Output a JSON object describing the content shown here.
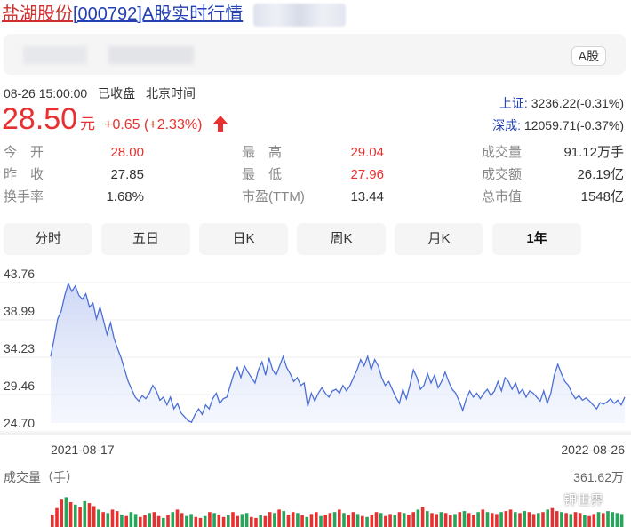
{
  "header": {
    "stock_name": "盐湖股份",
    "rest": "[000792]A股实时行情"
  },
  "info_bar": {
    "badge": "A股"
  },
  "status": {
    "datetime": "08-26 15:00:00",
    "state": "已收盘",
    "timezone": "北京时间"
  },
  "quote": {
    "price": "28.50",
    "unit": "元",
    "change": "+0.65 (+2.33%)"
  },
  "indices": [
    {
      "label": "上证:",
      "value": "3236.22(-0.31%)"
    },
    {
      "label": "深成:",
      "value": "12059.71(-0.37%)"
    }
  ],
  "stats": [
    [
      {
        "label": "今　开",
        "value": "28.00",
        "color": "red"
      },
      {
        "label": "最　高",
        "value": "29.04",
        "color": "red"
      },
      {
        "label": "成交量",
        "value": "91.12万手",
        "color": "black"
      }
    ],
    [
      {
        "label": "昨　收",
        "value": "27.85",
        "color": "black"
      },
      {
        "label": "最　低",
        "value": "27.96",
        "color": "red"
      },
      {
        "label": "成交额",
        "value": "26.19亿",
        "color": "black"
      }
    ],
    [
      {
        "label": "换手率",
        "value": "1.68%",
        "color": "black"
      },
      {
        "label": "市盈(TTM)",
        "value": "13.44",
        "color": "black"
      },
      {
        "label": "总市值",
        "value": "1548亿",
        "color": "black"
      }
    ]
  ],
  "tabs": [
    {
      "label": "分时",
      "active": false
    },
    {
      "label": "五日",
      "active": false
    },
    {
      "label": "日K",
      "active": false
    },
    {
      "label": "周K",
      "active": false
    },
    {
      "label": "月K",
      "active": false
    },
    {
      "label": "1年",
      "active": true
    }
  ],
  "colors": {
    "up": "#e93030",
    "down": "#26a65b",
    "line": "#4b6fd6",
    "link": "#2440b3"
  },
  "chart_data": {
    "type": "area",
    "y_ticks": [
      "43.76",
      "38.99",
      "34.23",
      "29.46",
      "24.70"
    ],
    "ylim": [
      24.7,
      43.76
    ],
    "x_start_label": "2021-08-17",
    "x_end_label": "2022-08-26",
    "series": [
      {
        "values": [
          33.2,
          35.5,
          38.0,
          39.0,
          41.0,
          42.5,
          41.5,
          42.2,
          41.0,
          40.5,
          41.2,
          39.5,
          40.0,
          38.0,
          39.5,
          37.8,
          36.0,
          37.5,
          35.5,
          34.2,
          33.0,
          31.5,
          30.0,
          29.0,
          28.0,
          27.5,
          28.2,
          27.8,
          28.5,
          29.5,
          28.8,
          27.6,
          28.0,
          27.0,
          28.0,
          26.5,
          27.2,
          26.0,
          25.5,
          25.0,
          24.8,
          25.8,
          26.5,
          25.8,
          27.0,
          26.5,
          27.8,
          28.5,
          27.2,
          27.8,
          28.0,
          29.5,
          31.0,
          31.8,
          30.5,
          32.0,
          31.2,
          30.5,
          29.8,
          31.5,
          32.5,
          30.8,
          33.0,
          31.5,
          30.8,
          32.0,
          33.2,
          31.8,
          31.0,
          30.0,
          30.5,
          29.5,
          29.8,
          26.8,
          28.5,
          27.5,
          28.5,
          29.2,
          28.5,
          28.0,
          28.8,
          29.0,
          28.5,
          29.5,
          28.8,
          29.5,
          30.5,
          31.5,
          32.8,
          32.0,
          33.2,
          31.5,
          32.8,
          32.0,
          30.5,
          29.5,
          30.0,
          29.0,
          28.0,
          27.2,
          29.0,
          27.8,
          29.5,
          31.5,
          30.5,
          29.0,
          29.5,
          31.0,
          29.8,
          30.8,
          29.2,
          30.0,
          31.2,
          30.0,
          29.0,
          28.5,
          27.5,
          26.3,
          27.8,
          28.8,
          28.0,
          28.5,
          27.8,
          28.5,
          29.0,
          28.2,
          28.8,
          30.0,
          28.8,
          30.5,
          30.0,
          29.0,
          29.8,
          28.5,
          29.0,
          28.0,
          28.8,
          28.5,
          28.0,
          27.5,
          28.8,
          27.2,
          28.5,
          30.8,
          32.2,
          31.0,
          30.0,
          29.5,
          28.5,
          27.8,
          28.2,
          27.6,
          27.9,
          27.5,
          27.0,
          26.5,
          27.3,
          27.1,
          27.4,
          27.8,
          27.2,
          27.6,
          27.0,
          28.0
        ]
      }
    ]
  },
  "volume": {
    "label": "成交量（手）",
    "max_label": "361.62万",
    "bars": [
      0.25,
      0.38,
      0.55,
      0.6,
      0.5,
      0.45,
      0.4,
      0.52,
      0.48,
      0.42,
      0.35,
      0.3,
      0.28,
      0.35,
      0.32,
      0.25,
      0.22,
      0.3,
      0.26,
      0.2,
      0.24,
      0.28,
      0.3,
      0.22,
      0.18,
      0.25,
      0.3,
      0.35,
      0.28,
      0.22,
      0.26,
      0.2,
      0.18,
      0.22,
      0.3,
      0.28,
      0.25,
      0.2,
      0.24,
      0.3,
      0.22,
      0.26,
      0.28,
      0.2,
      0.18,
      0.24,
      0.22,
      0.3,
      0.28,
      0.35,
      0.32,
      0.25,
      0.3,
      0.28,
      0.24,
      0.2,
      0.26,
      0.3,
      0.22,
      0.25,
      0.28,
      0.3,
      0.35,
      0.28,
      0.24,
      0.3,
      0.26,
      0.22,
      0.2,
      0.25,
      0.3,
      0.28,
      0.22,
      0.26,
      0.24,
      0.3,
      0.28,
      0.25,
      0.3,
      0.35,
      0.4,
      0.32,
      0.28,
      0.26,
      0.3,
      0.28,
      0.24,
      0.26,
      0.3,
      0.32,
      0.28,
      0.25,
      0.3,
      0.35,
      0.3,
      0.28,
      0.26,
      0.3,
      0.32,
      0.35,
      0.3,
      0.28,
      0.32,
      0.3,
      0.26,
      0.28,
      0.3,
      0.35,
      0.38,
      0.32,
      0.3,
      0.28,
      0.26,
      0.3,
      0.28,
      0.25,
      0.22,
      0.26,
      0.3,
      0.28,
      0.32,
      0.3,
      0.28,
      0.26
    ],
    "bar_up": [
      1,
      1,
      1,
      0,
      1,
      0,
      1,
      0,
      1,
      1,
      0,
      1,
      0,
      1,
      1,
      0,
      1,
      0,
      0,
      1,
      1,
      0,
      1,
      1,
      0,
      1,
      0,
      1,
      1,
      0,
      0,
      1,
      1,
      0,
      1,
      0,
      1,
      1,
      0,
      1,
      1,
      0,
      0,
      1,
      1,
      0,
      1,
      1,
      0,
      1,
      0,
      1,
      1,
      0,
      1,
      0,
      1,
      1,
      0,
      1,
      1,
      0,
      1,
      0,
      1,
      1,
      0,
      1,
      0,
      1,
      1,
      0,
      1,
      1,
      0,
      1,
      0,
      1,
      1,
      0,
      1,
      0,
      1,
      1,
      0,
      1,
      1,
      0,
      1,
      0,
      1,
      1,
      0,
      1,
      0,
      1,
      1,
      0,
      1,
      1,
      0,
      1,
      0,
      1,
      1,
      0,
      1,
      0,
      1,
      1,
      0,
      1,
      0,
      1,
      1,
      0,
      1,
      1,
      0,
      1
    ]
  },
  "watermark": {
    "text": "钾世界"
  }
}
